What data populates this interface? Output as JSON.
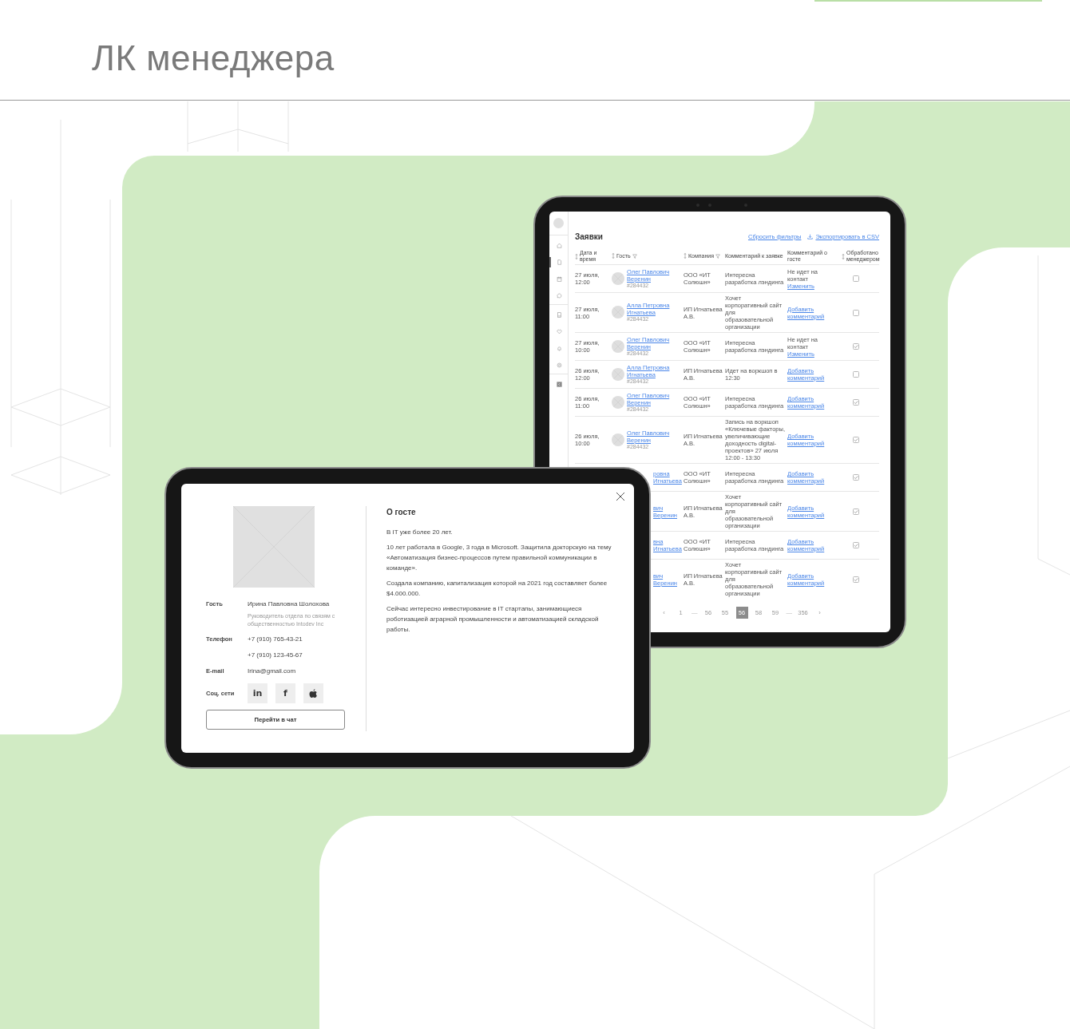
{
  "header": {
    "title": "ЛК менеджера"
  },
  "requests_screen": {
    "sidebar": {
      "groups": [
        {
          "items": [
            {
              "selected": false
            },
            {
              "selected": true
            },
            {
              "selected": false
            },
            {
              "selected": false
            }
          ]
        },
        {
          "items": [
            {
              "selected": false
            },
            {
              "selected": false
            },
            {
              "selected": false
            },
            {
              "selected": false
            }
          ]
        },
        {
          "items": [
            {
              "selected": false
            }
          ]
        }
      ]
    },
    "title": "Заявки",
    "actions": [
      {
        "kind": "link",
        "label": "Сбросить фильтры"
      },
      {
        "kind": "download",
        "label": "Экспортировать в CSV"
      }
    ],
    "table": {
      "columns": [
        {
          "label": "Дата и время",
          "sortable": true,
          "filterable": false
        },
        {
          "label": "Гость",
          "sortable": true,
          "filterable": true
        },
        {
          "label": "Компания",
          "sortable": true,
          "filterable": true
        },
        {
          "label": "Комментарий к заявке",
          "sortable": false,
          "filterable": false
        },
        {
          "label": "Комментарий о госте",
          "sortable": false,
          "filterable": false
        },
        {
          "label": "Обработано менеджером",
          "sortable": true,
          "filterable": false
        }
      ],
      "rows": [
        {
          "kind": "full",
          "date": "27 июля, 12:00",
          "guest": {
            "name": "Олег Павлович Веренин",
            "id": "#284432"
          },
          "company": "ООО «ИТ Солюшн»",
          "request_comment": "Интересна разработка лэндинга",
          "guest_comment": {
            "text": "Не идет на контакт",
            "link": "Изменить"
          },
          "checked": false
        },
        {
          "kind": "full",
          "date": "27 июля, 11:00",
          "guest": {
            "name": "Алла Петровна Игнатьева",
            "id": "#284432"
          },
          "company": "ИП Игнатьева А.В.",
          "request_comment": "Хочет корпоративный сайт для образовательной организации",
          "guest_comment": {
            "link": "Добавить комментарий"
          },
          "checked": false
        },
        {
          "kind": "full",
          "date": "27 июля, 10:00",
          "guest": {
            "name": "Олег Павлович Веренин",
            "id": "#284432"
          },
          "company": "ООО «ИТ Солюшн»",
          "request_comment": "Интересна разработка лэндинга",
          "guest_comment": {
            "text": "Не идет на контакт",
            "link": "Изменить"
          },
          "checked": true
        },
        {
          "kind": "full",
          "date": "26 июля, 12:00",
          "guest": {
            "name": "Алла Петровна Игнатьева",
            "id": "#284432"
          },
          "company": "ИП Игнатьева А.В.",
          "request_comment": "Идет на воркшоп в 12:30",
          "guest_comment": {
            "link": "Добавить комментарий"
          },
          "checked": false
        },
        {
          "kind": "full",
          "date": "26 июля, 11:00",
          "guest": {
            "name": "Олег Павлович Веренин",
            "id": "#284432"
          },
          "company": "ООО «ИТ Солюшн»",
          "request_comment": "Интересна разработка лэндинга",
          "guest_comment": {
            "link": "Добавить комментарий"
          },
          "checked": true
        },
        {
          "kind": "full",
          "date": "26 июля, 10:00",
          "guest": {
            "name": "Олег Павлович Веренин",
            "id": "#284432"
          },
          "company": "ИП Игнатьева А.В.",
          "request_comment": "Запись на воркшоп «Ключевые факторы, увеличивающие доходность digital-проектов» 27 июля 12:00 - 13:30",
          "guest_comment": {
            "link": "Добавить комментарий"
          },
          "checked": true
        },
        {
          "kind": "covered",
          "guest": {
            "name": "ровна Игнатьева"
          },
          "company": "ООО «ИТ Солюшн»",
          "request_comment": "Интересна разработка лэндинга",
          "guest_comment": {
            "link": "Добавить комментарий"
          },
          "checked": true
        },
        {
          "kind": "covered",
          "guest": {
            "name": "вич Веренин"
          },
          "company": "ИП Игнатьева А.В.",
          "request_comment": "Хочет корпоративный сайт для образовательной организации",
          "guest_comment": {
            "link": "Добавить комментарий"
          },
          "checked": true
        },
        {
          "kind": "covered",
          "guest": {
            "name": "вна Игнатьева"
          },
          "company": "ООО «ИТ Солюшн»",
          "request_comment": "Интересна разработка лэндинга",
          "guest_comment": {
            "link": "Добавить комментарий"
          },
          "checked": true
        },
        {
          "kind": "covered",
          "guest": {
            "name": "вич Веренин"
          },
          "company": "ИП Игнатьева А.В.",
          "request_comment": "Хочет корпоративный сайт для образовательной организации",
          "guest_comment": {
            "link": "Добавить комментарий"
          },
          "checked": true
        }
      ]
    },
    "pagination": [
      {
        "kind": "arrow",
        "label": "‹"
      },
      {
        "kind": "page",
        "label": "1",
        "selected": false
      },
      {
        "kind": "gap",
        "label": "—"
      },
      {
        "kind": "page",
        "label": "56",
        "selected": false
      },
      {
        "kind": "page",
        "label": "55",
        "selected": false
      },
      {
        "kind": "page",
        "label": "56",
        "selected": true
      },
      {
        "kind": "page",
        "label": "58",
        "selected": false
      },
      {
        "kind": "page",
        "label": "59",
        "selected": false
      },
      {
        "kind": "gap",
        "label": "—"
      },
      {
        "kind": "page",
        "label": "356",
        "selected": false
      },
      {
        "kind": "arrow",
        "label": "›"
      }
    ]
  },
  "guest_card": {
    "fields": [
      {
        "label": "Гость",
        "values": [
          {
            "kind": "main",
            "text": "Ирина Павловна Шолохова"
          },
          {
            "kind": "note",
            "text": "Руководитель отдела по связям с общественностью Intodev Inc"
          }
        ]
      },
      {
        "label": "Телефон",
        "values": [
          {
            "kind": "main",
            "text": "+7 (910) 765-43-21"
          },
          {
            "kind": "main",
            "text": "+7 (910) 123-45-67"
          }
        ]
      },
      {
        "label": "E-mail",
        "values": [
          {
            "kind": "main",
            "text": "Irina@gmail.com"
          }
        ]
      }
    ],
    "socials_label": "Соц. сети",
    "socials": [
      {
        "kind": "linkedin",
        "glyph": "in"
      },
      {
        "kind": "facebook",
        "glyph": "f"
      },
      {
        "kind": "apple"
      }
    ],
    "button": "Перейти в чат",
    "about": {
      "title": "О госте",
      "paragraphs": [
        "В IT уже более 20 лет.",
        "10 лет работала в Google, 3 года в Microsoft. Защитила докторскую на тему «Автоматизация бизнес-процессов путем правильной коммуникации в команде».",
        "Создала компанию, капитализация которой на 2021 год составляет более $4.000.000.",
        "Сейчас интересно инвестирование в IT стартапы, занимающиеся роботизацией аграрной промышленности и автоматизацией складской работы."
      ]
    }
  }
}
